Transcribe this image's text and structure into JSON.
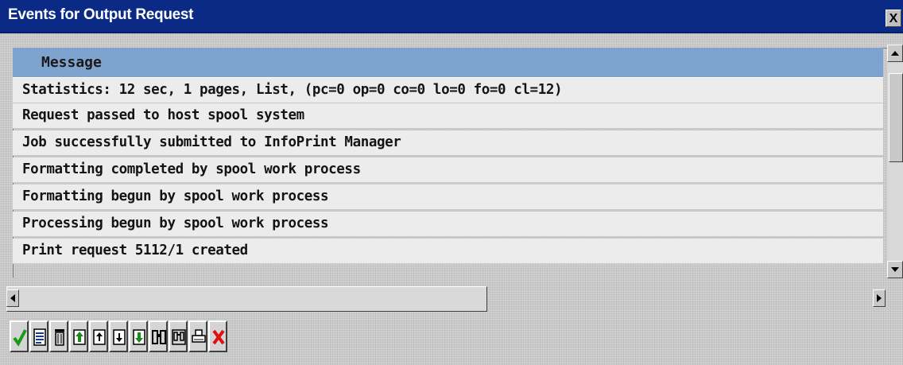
{
  "window": {
    "title": "Events for Output Request",
    "close_label": "X"
  },
  "list": {
    "header": "Message",
    "rows": [
      "Statistics: 12 sec, 1 pages, List, (pc=0 op=0 co=0 lo=0 fo=0 cl=12)",
      "Request passed to host spool system",
      "Job successfully submitted to InfoPrint Manager",
      "Formatting completed by spool work process",
      "Formatting begun by spool work process",
      "Processing begun by spool work process",
      "Print request 5112/1 created"
    ]
  },
  "toolbar": {
    "buttons": [
      {
        "icon": "checkmark-icon",
        "color": "#1a9a1a"
      },
      {
        "icon": "detail-list-icon",
        "color": "#1a3a8a"
      },
      {
        "icon": "delete-icon",
        "color": "#000000"
      },
      {
        "icon": "first-page-icon",
        "color": "#1a8a1a"
      },
      {
        "icon": "previous-page-icon",
        "color": "#000000"
      },
      {
        "icon": "next-page-icon",
        "color": "#000000"
      },
      {
        "icon": "last-page-icon",
        "color": "#1a8a1a"
      },
      {
        "icon": "find-icon",
        "color": "#000000"
      },
      {
        "icon": "find-next-icon",
        "color": "#000000"
      },
      {
        "icon": "print-icon",
        "color": "#000000"
      },
      {
        "icon": "cancel-icon",
        "color": "#e01010"
      }
    ]
  },
  "colors": {
    "titlebar": "#0a2a86",
    "header": "#7fa3cf",
    "row": "#ececec"
  }
}
